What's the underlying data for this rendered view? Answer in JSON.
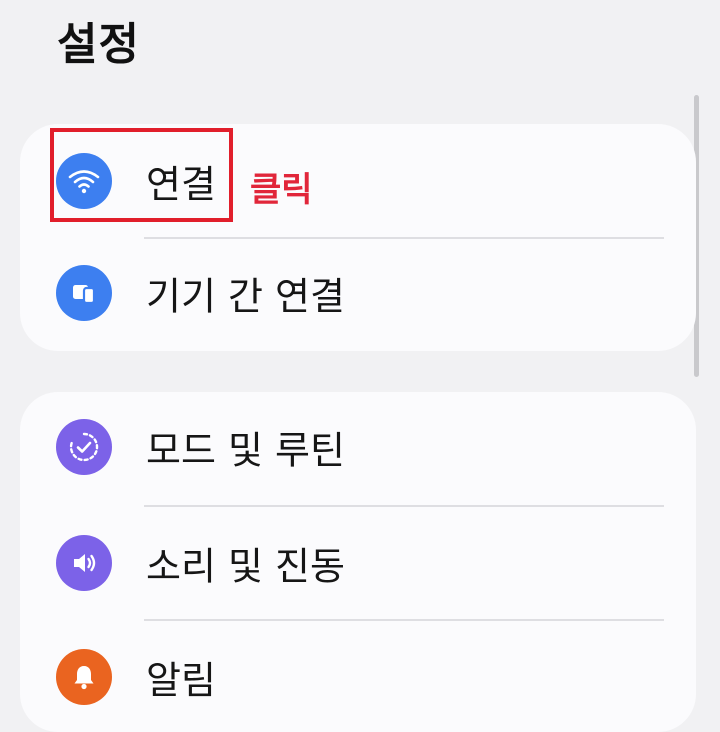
{
  "header": {
    "title": "설정"
  },
  "annotation": {
    "click_label": "클릭"
  },
  "groups": [
    {
      "items": [
        {
          "label": "연결",
          "icon": "wifi-icon",
          "icon_color": "#3d7ff0"
        },
        {
          "label": "기기 간 연결",
          "icon": "devices-icon",
          "icon_color": "#3d7ff0"
        }
      ]
    },
    {
      "items": [
        {
          "label": "모드 및 루틴",
          "icon": "routine-check-icon",
          "icon_color": "#7c62e8"
        },
        {
          "label": "소리 및 진동",
          "icon": "speaker-icon",
          "icon_color": "#7c62e8"
        },
        {
          "label": "알림",
          "icon": "bell-icon",
          "icon_color": "#ea6420"
        }
      ]
    }
  ],
  "colors": {
    "background": "#f1f1f3",
    "card": "#fbfbfd",
    "highlight": "#e11e2b"
  }
}
